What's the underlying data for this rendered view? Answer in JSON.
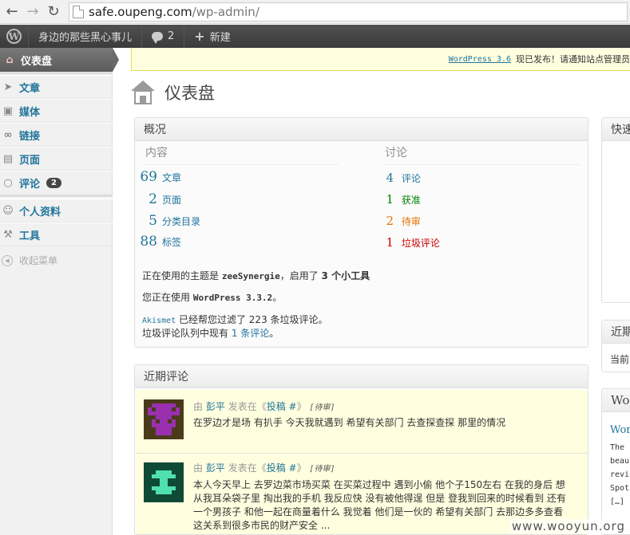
{
  "browser": {
    "url_host": "safe.oupeng.com",
    "url_path": "/wp-admin/"
  },
  "admin_bar": {
    "site_name": "身边的那些黑心事儿",
    "comments_count": "2",
    "new_label": "新建"
  },
  "sidebar": {
    "current": "仪表盘",
    "items": [
      {
        "label": "文章",
        "icon": "pin-icon"
      },
      {
        "label": "媒体",
        "icon": "media-icon"
      },
      {
        "label": "链接",
        "icon": "link-icon"
      },
      {
        "label": "页面",
        "icon": "page-icon"
      },
      {
        "label": "评论",
        "icon": "comment-icon",
        "badge": "2"
      },
      {
        "label": "个人资料",
        "icon": "users-icon"
      },
      {
        "label": "工具",
        "icon": "tools-icon"
      }
    ],
    "collapse": "收起菜单"
  },
  "nag": {
    "link": "WordPress 3.6",
    "text": "现已发布！请通知站点管理员"
  },
  "page_title": "仪表盘",
  "right_now": {
    "title": "概况",
    "content_heading": "内容",
    "discussion_heading": "讨论",
    "content": [
      {
        "num": "69",
        "label": "文章"
      },
      {
        "num": "2",
        "label": "页面"
      },
      {
        "num": "5",
        "label": "分类目录"
      },
      {
        "num": "88",
        "label": "标签"
      }
    ],
    "discussion": [
      {
        "num": "4",
        "label": "评论"
      },
      {
        "num": "1",
        "label": "获准"
      },
      {
        "num": "2",
        "label": "待审"
      },
      {
        "num": "1",
        "label": "垃圾评论"
      }
    ],
    "theme_prefix": "正在使用的主题是",
    "theme_name": "zeeSynergie",
    "theme_mid": "，启用了",
    "widgets": "3 个小工具",
    "version_prefix": "您正在使用",
    "version": "WordPress 3.3.2",
    "version_suffix": "。",
    "akismet_link": "Akismet",
    "akismet_text": "已经帮您过滤了 223 条垃圾评论。",
    "spam_queue_prefix": "垃圾评论队列中现有",
    "spam_queue_link": "1 条评论",
    "spam_queue_suffix": "。"
  },
  "recent_comments": {
    "title": "近期评论",
    "items": [
      {
        "by": "由",
        "author": "彭平",
        "on": "发表在《",
        "post": "投稿 #",
        "close": "》",
        "status": "[待审]",
        "text": "在罗边才是场 有扒手 今天我就遇到 希望有关部门 去查探查探 那里的情况"
      },
      {
        "by": "由",
        "author": "彭平",
        "on": "发表在《",
        "post": "投稿 #",
        "close": "》",
        "status": "[待审]",
        "text": "本人今天早上 去罗边菜市场买菜 在买菜过程中 遇到小偷 他个子150左右 在我的身后 想从我耳朵袋子里 掏出我的手机 我反应快 没有被他得逞 但是 登我到回来的时候看到 还有一个男孩子 和他一起在商量着什么 我觉着 他们是一伙的 希望有关部门 去那边多多查看 这关系到很多市民的财产安全 ..."
      }
    ]
  },
  "quick_press": {
    "title": "快速"
  },
  "recent_drafts": {
    "title": "近期",
    "body": "当前"
  },
  "wp_news": {
    "title": "Wor",
    "link": "Wor",
    "lines": [
      "The ",
      "beau",
      "revi",
      "Spot",
      "[…]"
    ]
  },
  "watermark": "www.wooyun.org",
  "colors": {
    "link": "#21759b",
    "admin_bar": "#464646",
    "approved": "#008000",
    "pending": "#e66f00",
    "spam": "#cc0000",
    "nag_bg": "#ffffe0"
  }
}
